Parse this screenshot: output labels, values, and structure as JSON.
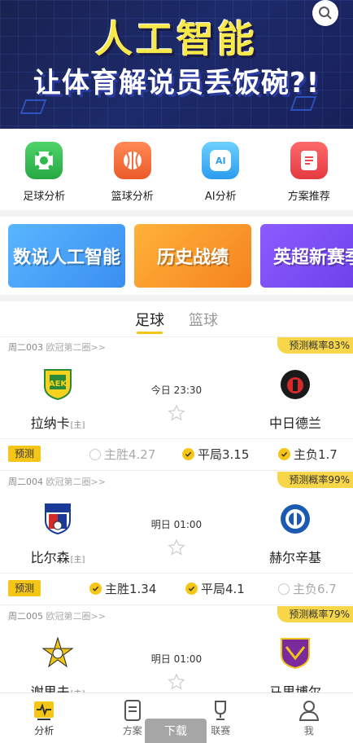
{
  "banner": {
    "line1": "人工智能",
    "line2": "让体育解说员丢饭碗?!"
  },
  "menu": [
    {
      "label": "足球分析",
      "icon": "soccer-ball-icon",
      "color": "#2dbb4b"
    },
    {
      "label": "篮球分析",
      "icon": "basketball-icon",
      "color": "#f36e3c"
    },
    {
      "label": "AI分析",
      "icon": "ai-chip-icon",
      "color": "#3fb3f5",
      "glyph": "AI"
    },
    {
      "label": "方案推荐",
      "icon": "document-icon",
      "color": "#f0464d"
    }
  ],
  "promos": [
    {
      "text": "数说人工智能",
      "color": "#4da8f0"
    },
    {
      "text": "历史战绩",
      "color": "#f59a23"
    },
    {
      "text": "英超新赛季",
      "color": "#7b4ff0"
    }
  ],
  "tabs": [
    {
      "label": "足球"
    },
    {
      "label": "篮球"
    }
  ],
  "matches": [
    {
      "code": "周二003",
      "league": "欧冠第二圈>>",
      "prob": "预测概率83%",
      "time": "今日 23:30",
      "home": {
        "name": "拉纳卡",
        "tag": "[主]"
      },
      "away": {
        "name": "中日德兰"
      },
      "predict": "预测",
      "odds": [
        {
          "text": "主胜4.27",
          "sel": false
        },
        {
          "text": "平局3.15",
          "sel": true
        },
        {
          "text": "主负1.7",
          "sel": true
        }
      ]
    },
    {
      "code": "周二004",
      "league": "欧冠第二圈>>",
      "prob": "预测概率99%",
      "time": "明日 01:00",
      "home": {
        "name": "比尔森",
        "tag": "[主]"
      },
      "away": {
        "name": "赫尔辛基"
      },
      "predict": "预测",
      "odds": [
        {
          "text": "主胜1.34",
          "sel": true
        },
        {
          "text": "平局4.1",
          "sel": true
        },
        {
          "text": "主负6.7",
          "sel": false
        }
      ]
    },
    {
      "code": "周二005",
      "league": "欧冠第二圈>>",
      "prob": "预测概率79%",
      "time": "明日 01:00",
      "home": {
        "name": "谢里夫",
        "tag": "[主]"
      },
      "away": {
        "name": "马里博尔"
      }
    }
  ],
  "nav": [
    {
      "label": "分析"
    },
    {
      "label": "方案"
    },
    {
      "label": "联赛"
    },
    {
      "label": "我"
    }
  ],
  "download": "下载"
}
